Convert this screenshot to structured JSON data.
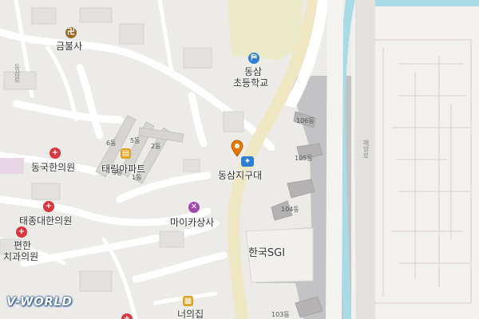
{
  "map": {
    "provider_logo": "V-WORLD",
    "places": {
      "temple": "금불사",
      "school_line1": "동삼",
      "school_line2": "초등학교",
      "police": "동삼지구대",
      "apartment": "태림아파트",
      "clinic_donguk": "동국한의원",
      "clinic_taejong": "태종대한의원",
      "clinic_pyeonhan_line1": "편한",
      "clinic_pyeonhan_line2": "치과의원",
      "shop": "마이카상사",
      "company": "한국SGI",
      "restaurant": "너의집"
    },
    "buildings": {
      "b106": "106동",
      "b105": "105동",
      "b104": "104동",
      "b103": "103동",
      "b6": "6동",
      "b5": "5동",
      "b2": "2동",
      "b3": "3동",
      "b1": "1동"
    },
    "roads": {
      "road_left": "동삼로",
      "road_right": "해양로"
    },
    "icons": {
      "temple": "buddhist-temple-icon",
      "school": "school-icon",
      "police": "police-station-icon",
      "apartment": "apartment-icon",
      "hospital": "hospital-icon",
      "shop": "repair-shop-icon",
      "restaurant": "restaurant-icon",
      "pin": "location-pin-icon"
    },
    "colors": {
      "background": "#ecebe8",
      "road": "#ffffff",
      "main_road": "#efe6c2",
      "water": "#a9dbe6",
      "dark_area": "#c3c3c6",
      "hospital": "#d9363e",
      "pin": "#e67a00"
    }
  }
}
